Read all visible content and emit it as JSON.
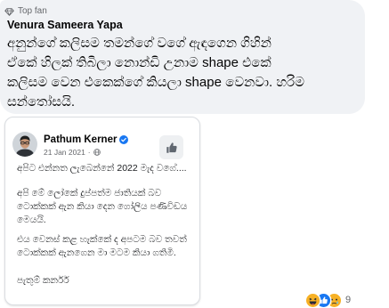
{
  "comment": {
    "badge_label": "Top fan",
    "badge_icon": "diamond-icon",
    "author": "Venura Sameera Yapa",
    "text_lines": [
      "අනුන්ගේ කලිසම තමන්ගේ වගේ ඇඳගෙන ගිහින්",
      "ඒකේ හිලක් තිබිලා නොන්ඩි උනාම shape එකේ",
      "කලිසම වෙන එකෙක්ගේ කියලා shape වෙනවා. හරිම",
      "සන්තෝසයි."
    ]
  },
  "attachment": {
    "author": "Pathum Kerner",
    "verified": true,
    "date": "21 Jan 2021",
    "separator": "·",
    "privacy_icon": "globe-icon",
    "action_icon": "thumbs-up-icon",
    "paragraphs": [
      [
        "අපිට එන්නත ලැබෙන්නේ 2022 මැද වගේ...."
      ],
      [
        "අපි මේ ලෝකේ දුප්පත්ම ජාතියක් බව",
        "ටොක්කක් ඇන කියා දෙන ගෝලිය පණිවිඩය",
        "මෙයයි."
      ],
      [
        "එය වෙනස් කළ හැක්කේ ද අපටම බව තවත්",
        "ටොක්කක් ඇනගෙන මා මටම කියා ගතිමි."
      ],
      [
        "පැතුම් කර්නර්"
      ]
    ]
  },
  "reactions": {
    "icons": [
      "haha-icon",
      "like-icon",
      "sad-icon"
    ],
    "count": "9"
  },
  "colors": {
    "bubble_bg": "#f0f2f5",
    "text": "#050505",
    "secondary": "#65676b",
    "verified": "#1877f2",
    "card_border": "#dadde1"
  }
}
